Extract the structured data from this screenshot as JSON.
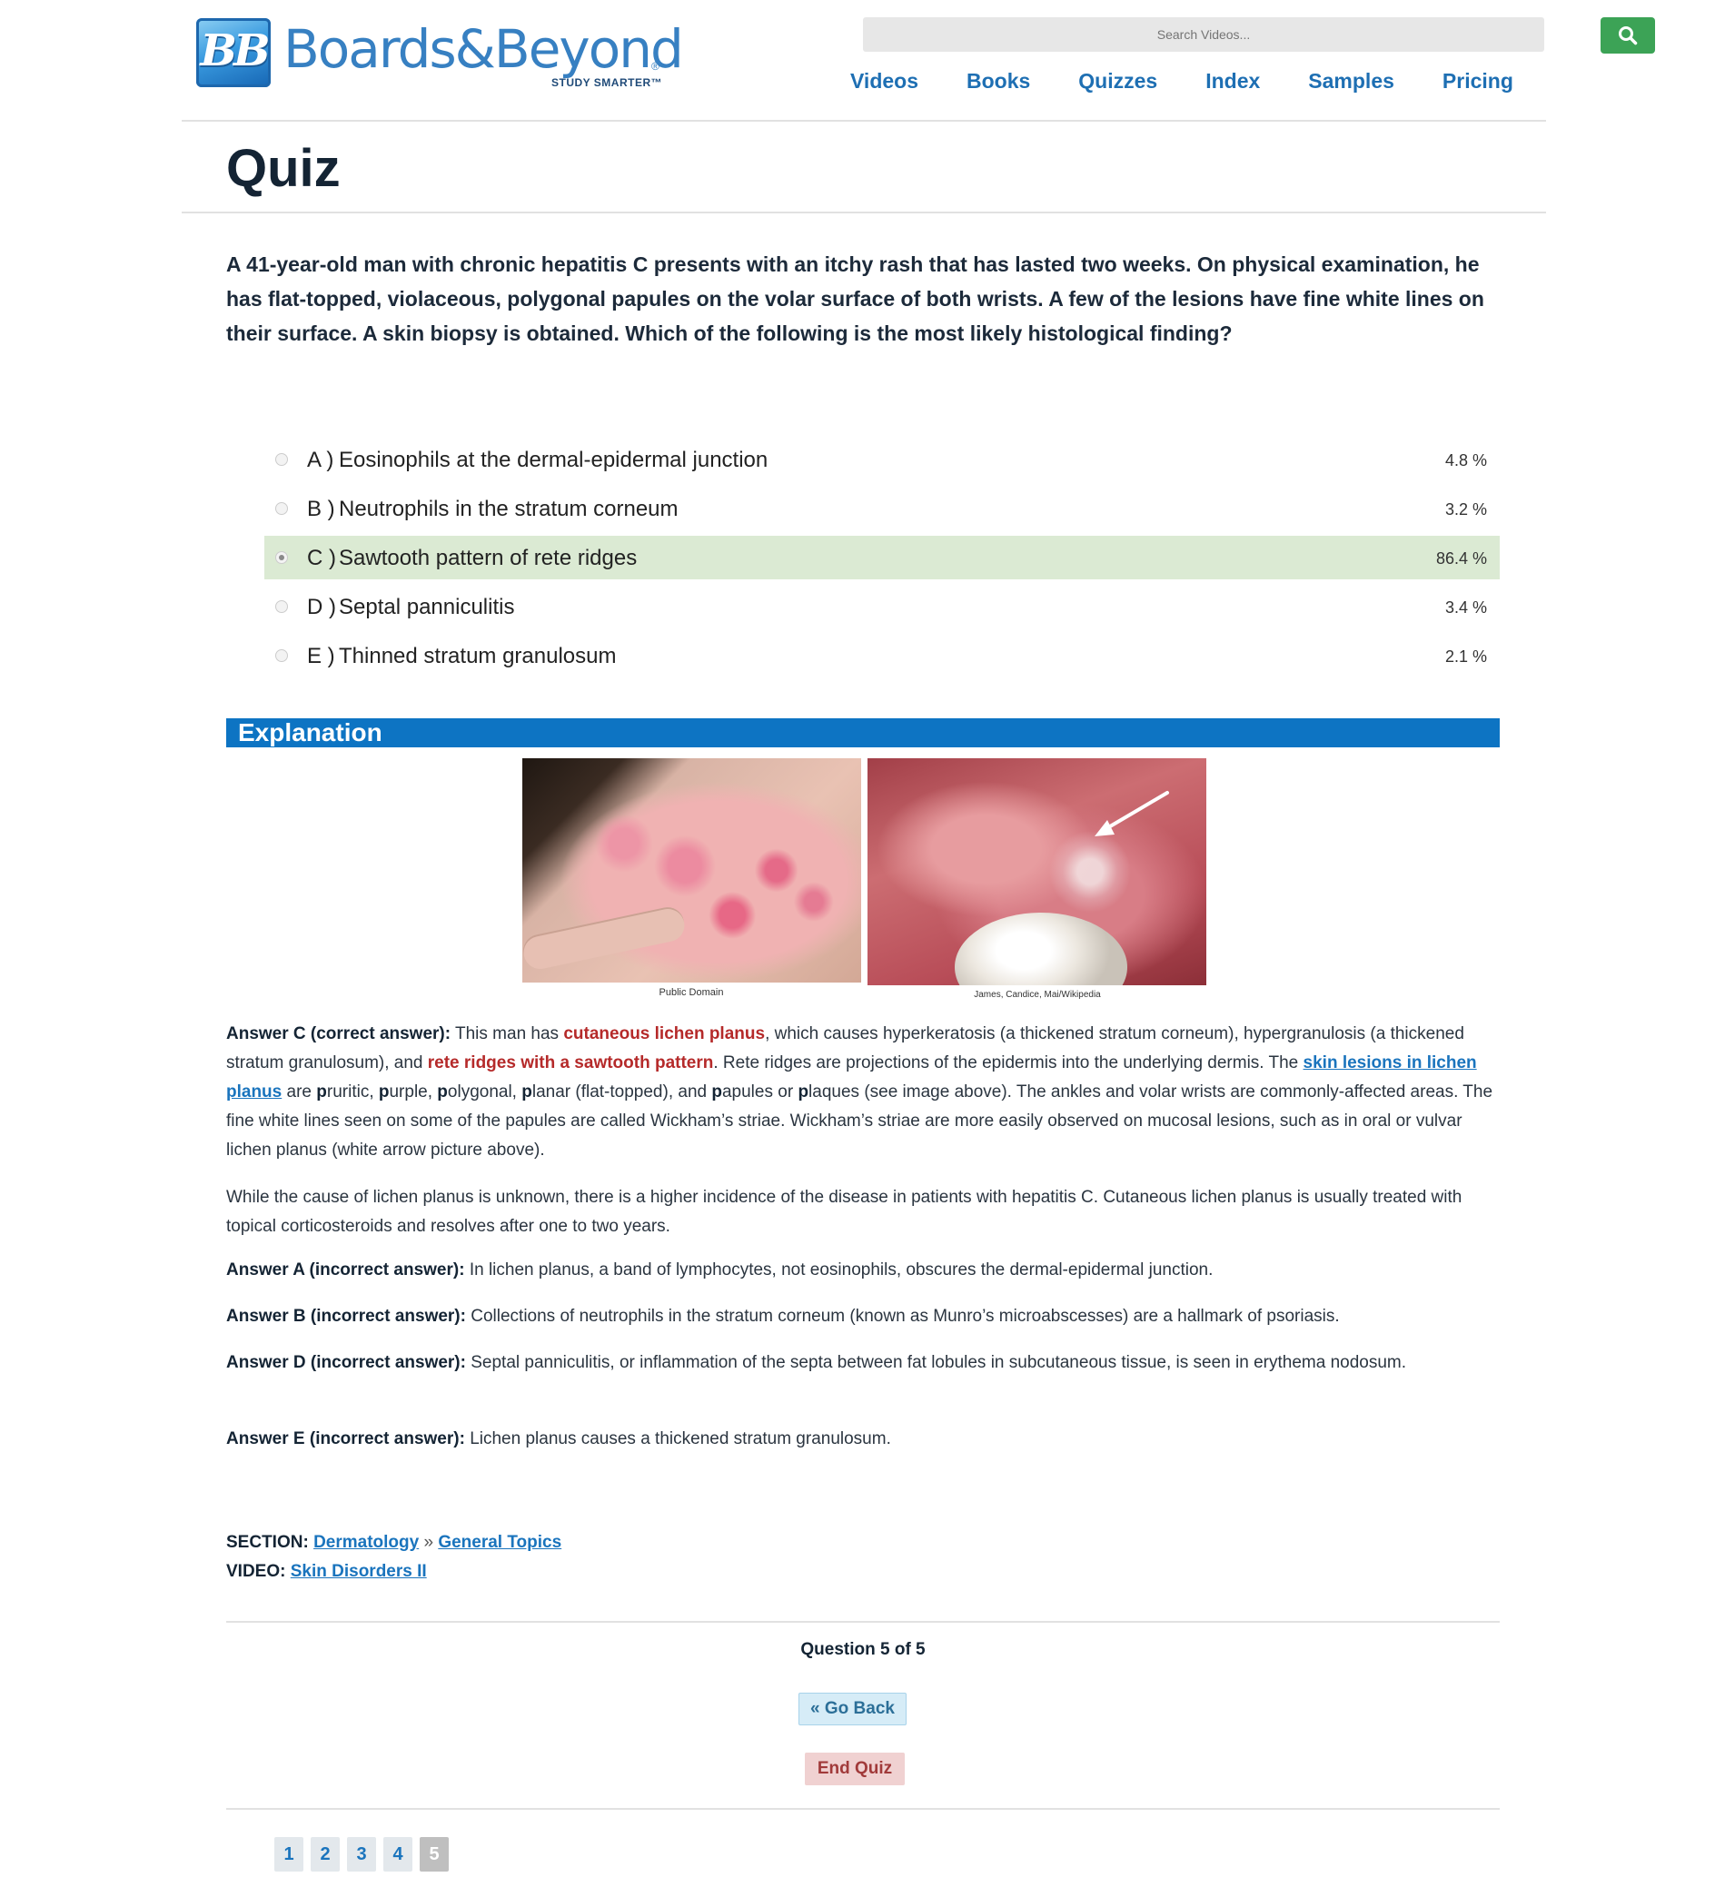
{
  "brand": {
    "badge": "BB",
    "name": "Boards&Beyond",
    "registered": "®",
    "tagline": "STUDY SMARTER™"
  },
  "search": {
    "placeholder": "Search Videos..."
  },
  "nav": [
    "Videos",
    "Books",
    "Quizzes",
    "Index",
    "Samples",
    "Pricing"
  ],
  "page_title": "Quiz",
  "question": "A 41-year-old man with chronic hepatitis C presents with an itchy rash that has lasted two weeks. On physical examination, he has flat-topped, violaceous, polygonal papules on the volar surface of both wrists. A few of the lesions have fine white lines on their surface. A skin biopsy is obtained. Which of the following is the most likely histological finding?",
  "choices": [
    {
      "letter": "A )",
      "text": "Eosinophils at the dermal-epidermal junction",
      "pct": "4.8 %",
      "selected": false,
      "correct": false
    },
    {
      "letter": "B )",
      "text": "Neutrophils in the stratum corneum",
      "pct": "3.2 %",
      "selected": false,
      "correct": false
    },
    {
      "letter": "C )",
      "text": "Sawtooth pattern of rete ridges",
      "pct": "86.4 %",
      "selected": true,
      "correct": true
    },
    {
      "letter": "D )",
      "text": "Septal panniculitis",
      "pct": "3.4 %",
      "selected": false,
      "correct": false
    },
    {
      "letter": "E )",
      "text": "Thinned stratum granulosum",
      "pct": "2.1 %",
      "selected": false,
      "correct": false
    }
  ],
  "explanation": {
    "heading": "Explanation",
    "image_credit_left": "Public Domain",
    "image_credit_right": "James, Candice, Mai/Wikipedia",
    "answer_c_label": "Answer C (correct answer):",
    "answer_c_1": " This man has ",
    "answer_c_red1": "cutaneous lichen planus",
    "answer_c_2": ", which causes hyperkeratosis (a thickened stratum corneum), hypergranulosis (a thickened stratum granulosum), and ",
    "answer_c_red2": "rete ridges with a sawtooth pattern",
    "answer_c_3": ". Rete ridges are projections of the epidermis into the underlying dermis. The ",
    "answer_c_link": "skin lesions in lichen planus",
    "answer_c_4a": " are ",
    "p1": "p",
    "answer_c_w1": "ruritic, ",
    "p2": "p",
    "answer_c_w2": "urple, ",
    "p3": "p",
    "answer_c_w3": "olygonal, ",
    "p4": "p",
    "answer_c_w4": "lanar (flat-topped), and ",
    "p5": "p",
    "answer_c_w5": "apules or ",
    "p6": "p",
    "answer_c_w6": "laques (see image above). The ankles and volar wrists are commonly-affected areas. The fine white lines seen on some of the papules are called Wickham’s striae. Wickham’s striae are more easily observed on mucosal lesions, such as in oral or vulvar lichen planus (white arrow picture above).",
    "para2": "While the cause of lichen planus is unknown, there is a higher incidence of the disease in patients with hepatitis C. Cutaneous lichen planus is usually treated with topical corticosteroids and resolves after one to two years.",
    "answer_a_label": "Answer A (incorrect answer):",
    "answer_a": " In lichen planus, a band of lymphocytes, not eosinophils, obscures the dermal-epidermal junction.",
    "answer_b_label": "Answer B (incorrect answer):",
    "answer_b": " Collections of neutrophils in the stratum corneum (known as Munro’s microabscesses) are a hallmark of psoriasis.",
    "answer_d_label": "Answer D (incorrect answer):",
    "answer_d": " Septal panniculitis, or inflammation of the septa between fat lobules in subcutaneous tissue, is seen in erythema nodosum.",
    "answer_e_label": "Answer E (incorrect answer):",
    "answer_e": " Lichen planus causes a thickened stratum granulosum."
  },
  "meta": {
    "section_label": "SECTION:",
    "section": "Dermatology",
    "separator": " » ",
    "subsection": "General Topics",
    "video_label": "VIDEO:",
    "video": "Skin Disorders II"
  },
  "footer": {
    "question_count": "Question 5 of 5",
    "go_back": "« Go Back",
    "end_quiz": "End Quiz",
    "pages": [
      "1",
      "2",
      "3",
      "4",
      "5"
    ],
    "current_page": "5"
  },
  "colors": {
    "nav_link": "#1e6fb3",
    "search_button": "#3ca356",
    "correct_highlight": "#dbead3",
    "explanation_bar": "#0d74c3",
    "highlight_red": "#b52a2a"
  },
  "icons": {
    "search": "search-icon"
  }
}
